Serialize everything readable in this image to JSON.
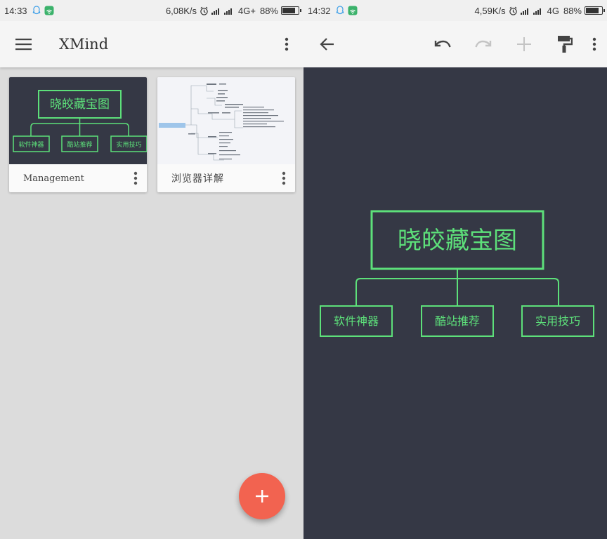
{
  "left": {
    "status": {
      "time": "14:33",
      "speed": "6,08K/s",
      "network": "4G+",
      "battery": "88%",
      "battery_level": 0.88
    },
    "appbar": {
      "title": "XMind"
    },
    "cards": [
      {
        "title": "Management",
        "map": {
          "root": "晓皎藏宝图",
          "children": [
            "软件神器",
            "酷站推荐",
            "实用技巧"
          ]
        }
      },
      {
        "title": "浏览器详解"
      }
    ]
  },
  "right": {
    "status": {
      "time": "14:32",
      "speed": "4,59K/s",
      "network": "4G",
      "battery": "88%",
      "battery_level": 0.88
    },
    "map": {
      "root": "晓皎藏宝图",
      "children": [
        "软件神器",
        "酷站推荐",
        "实用技巧"
      ]
    }
  },
  "colors": {
    "map_bg": "#353845",
    "node_green": "#5de07a",
    "fab": "#f26350",
    "appbar": "#f5f5f5"
  },
  "icons": [
    "qq-icon",
    "wifi-app-icon",
    "alarm-icon",
    "signal-icon",
    "battery-icon",
    "menu-icon",
    "more-vert-icon",
    "back-arrow-icon",
    "undo-icon",
    "redo-icon",
    "add-icon",
    "format-paint-icon"
  ]
}
